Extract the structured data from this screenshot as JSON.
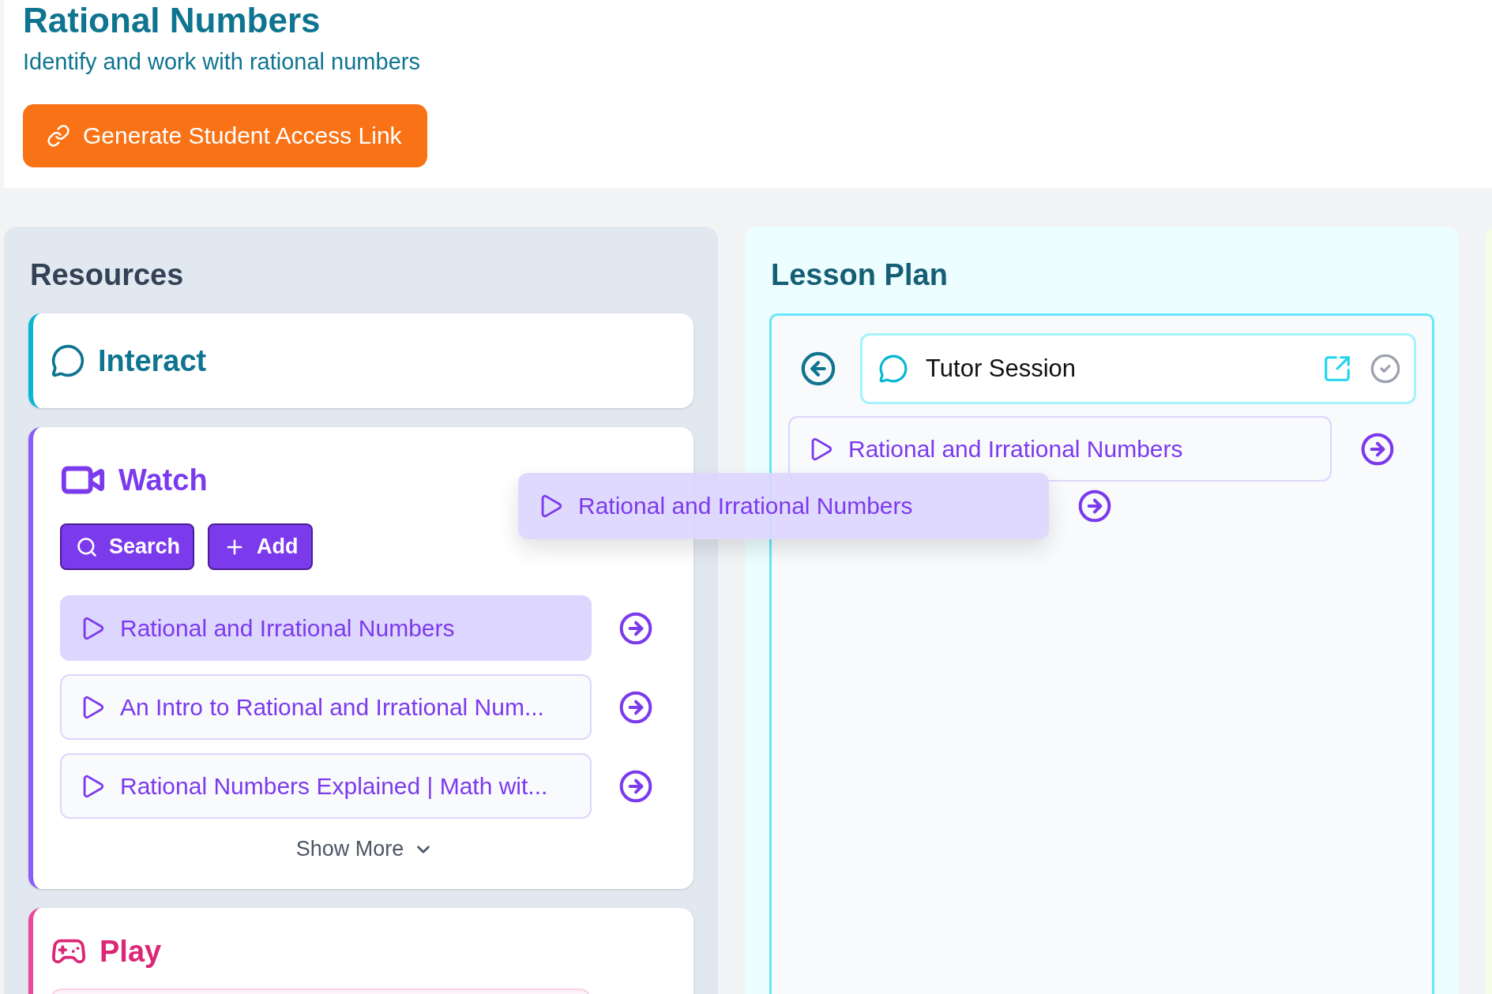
{
  "header": {
    "title": "Rational Numbers",
    "subtitle": "Identify and work with rational numbers",
    "access_button": "Generate Student Access Link"
  },
  "resources": {
    "heading": "Resources",
    "sections": [
      {
        "kind": "interact",
        "title": "Interact"
      },
      {
        "kind": "watch",
        "title": "Watch",
        "buttons": [
          {
            "kind": "search",
            "label": "Search"
          },
          {
            "kind": "add",
            "label": "Add"
          }
        ],
        "items": [
          {
            "title": "Rational and Irrational Numbers",
            "selected": true
          },
          {
            "title": "An Intro to Rational and Irrational Num...",
            "selected": false
          },
          {
            "title": "Rational Numbers Explained | Math wit...",
            "selected": false
          }
        ],
        "show_more": "Show More"
      },
      {
        "kind": "play",
        "title": "Play"
      }
    ]
  },
  "lesson_plan": {
    "heading": "Lesson Plan",
    "session": {
      "title": "Tutor Session",
      "completed": false
    },
    "items": [
      {
        "title": "Rational and Irrational Numbers"
      }
    ]
  },
  "drag_preview": {
    "title": "Rational and Irrational Numbers"
  }
}
